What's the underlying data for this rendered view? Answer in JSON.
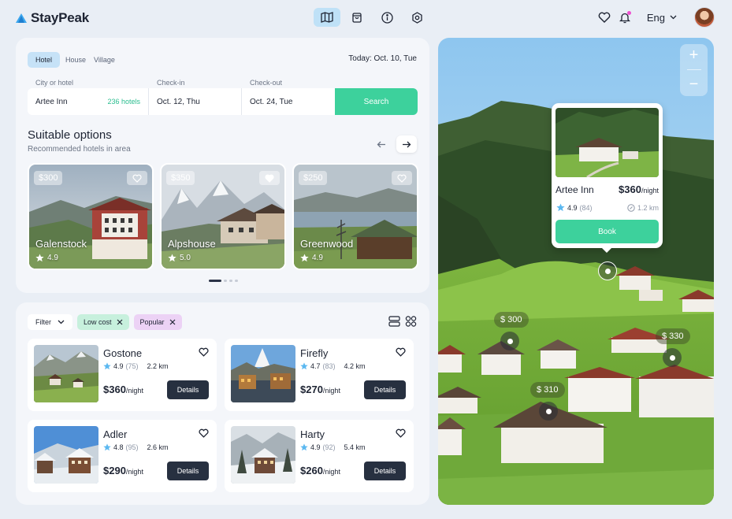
{
  "app": {
    "name": "StayPeak"
  },
  "header": {
    "nav_icons": [
      "map-icon",
      "shopping-bag-icon",
      "info-icon",
      "settings-icon"
    ],
    "language": "Eng"
  },
  "search": {
    "types": [
      "Hotel",
      "House",
      "Village"
    ],
    "active_type": "Hotel",
    "today": "Today: Oct. 10, Tue",
    "labels": {
      "city": "City or hotel",
      "checkin": "Check-in",
      "checkout": "Check-out"
    },
    "city": "Artee Inn",
    "count": "236 hotels",
    "checkin": "Oct. 12, Thu",
    "checkout": "Oct. 24, Tue",
    "button": "Search"
  },
  "suitable": {
    "title": "Suitable options",
    "subtitle": "Recommended hotels in area",
    "cards": [
      {
        "price": "$300",
        "name": "Galenstock",
        "rating": "4.9",
        "favorite": false
      },
      {
        "price": "$350",
        "name": "Alpshouse",
        "rating": "5.0",
        "favorite": true
      },
      {
        "price": "$250",
        "name": "Greenwood",
        "rating": "4.9",
        "favorite": false
      }
    ]
  },
  "filters": {
    "filter_label": "Filter",
    "tags": [
      "Low cost",
      "Popular"
    ]
  },
  "hotels": [
    {
      "name": "Gostone",
      "rating": "4.9",
      "reviews": "(75)",
      "distance": "2.2 km",
      "price": "$360",
      "unit": "/night",
      "button": "Details"
    },
    {
      "name": "Firefly",
      "rating": "4.7",
      "reviews": "(83)",
      "distance": "4.2 km",
      "price": "$270",
      "unit": "/night",
      "button": "Details"
    },
    {
      "name": "Adler",
      "rating": "4.8",
      "reviews": "(95)",
      "distance": "2.6 km",
      "price": "$290",
      "unit": "/night",
      "button": "Details"
    },
    {
      "name": "Harty",
      "rating": "4.9",
      "reviews": "(92)",
      "distance": "5.4 km",
      "price": "$260",
      "unit": "/night",
      "button": "Details"
    }
  ],
  "map": {
    "zoom_in": "+",
    "zoom_out": "−",
    "popup": {
      "name": "Artee Inn",
      "price": "$360",
      "unit": "/night",
      "rating": "4.9",
      "reviews": "(84)",
      "distance": "1.2 km",
      "button": "Book"
    },
    "price_markers": [
      "$ 300",
      "$ 330",
      "$ 310"
    ]
  },
  "colors": {
    "accent": "#3dd19c",
    "nav_active": "#bfe1f7",
    "dark_button": "#273040",
    "star": "#5bb8f0"
  }
}
